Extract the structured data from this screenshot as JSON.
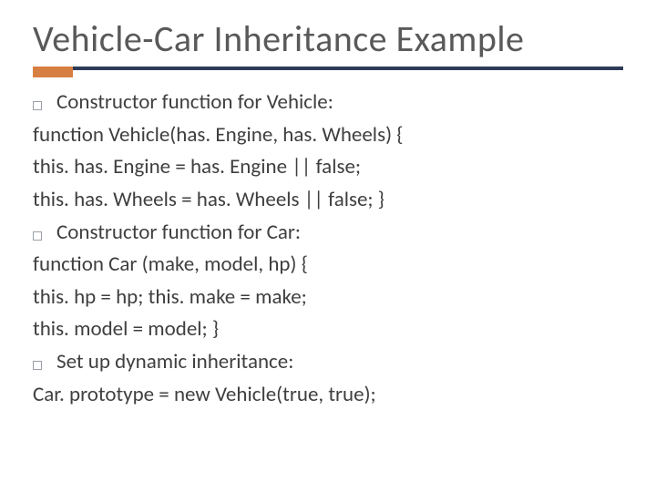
{
  "title": "Vehicle-Car Inheritance Example",
  "b1": "Constructor function for Vehicle:",
  "c1": "function Vehicle(has. Engine, has. Wheels) {",
  "c2": "this. has. Engine = has. Engine || false;",
  "c3": "this. has. Wheels = has. Wheels || false; }",
  "b2": "Constructor function for Car:",
  "c4": "function Car (make, model, hp) {",
  "c5": "this. hp = hp; this. make = make;",
  "c6": "this. model = model; }",
  "b3": "Set up dynamic inheritance:",
  "c7": "Car. prototype = new Vehicle(true, true);"
}
